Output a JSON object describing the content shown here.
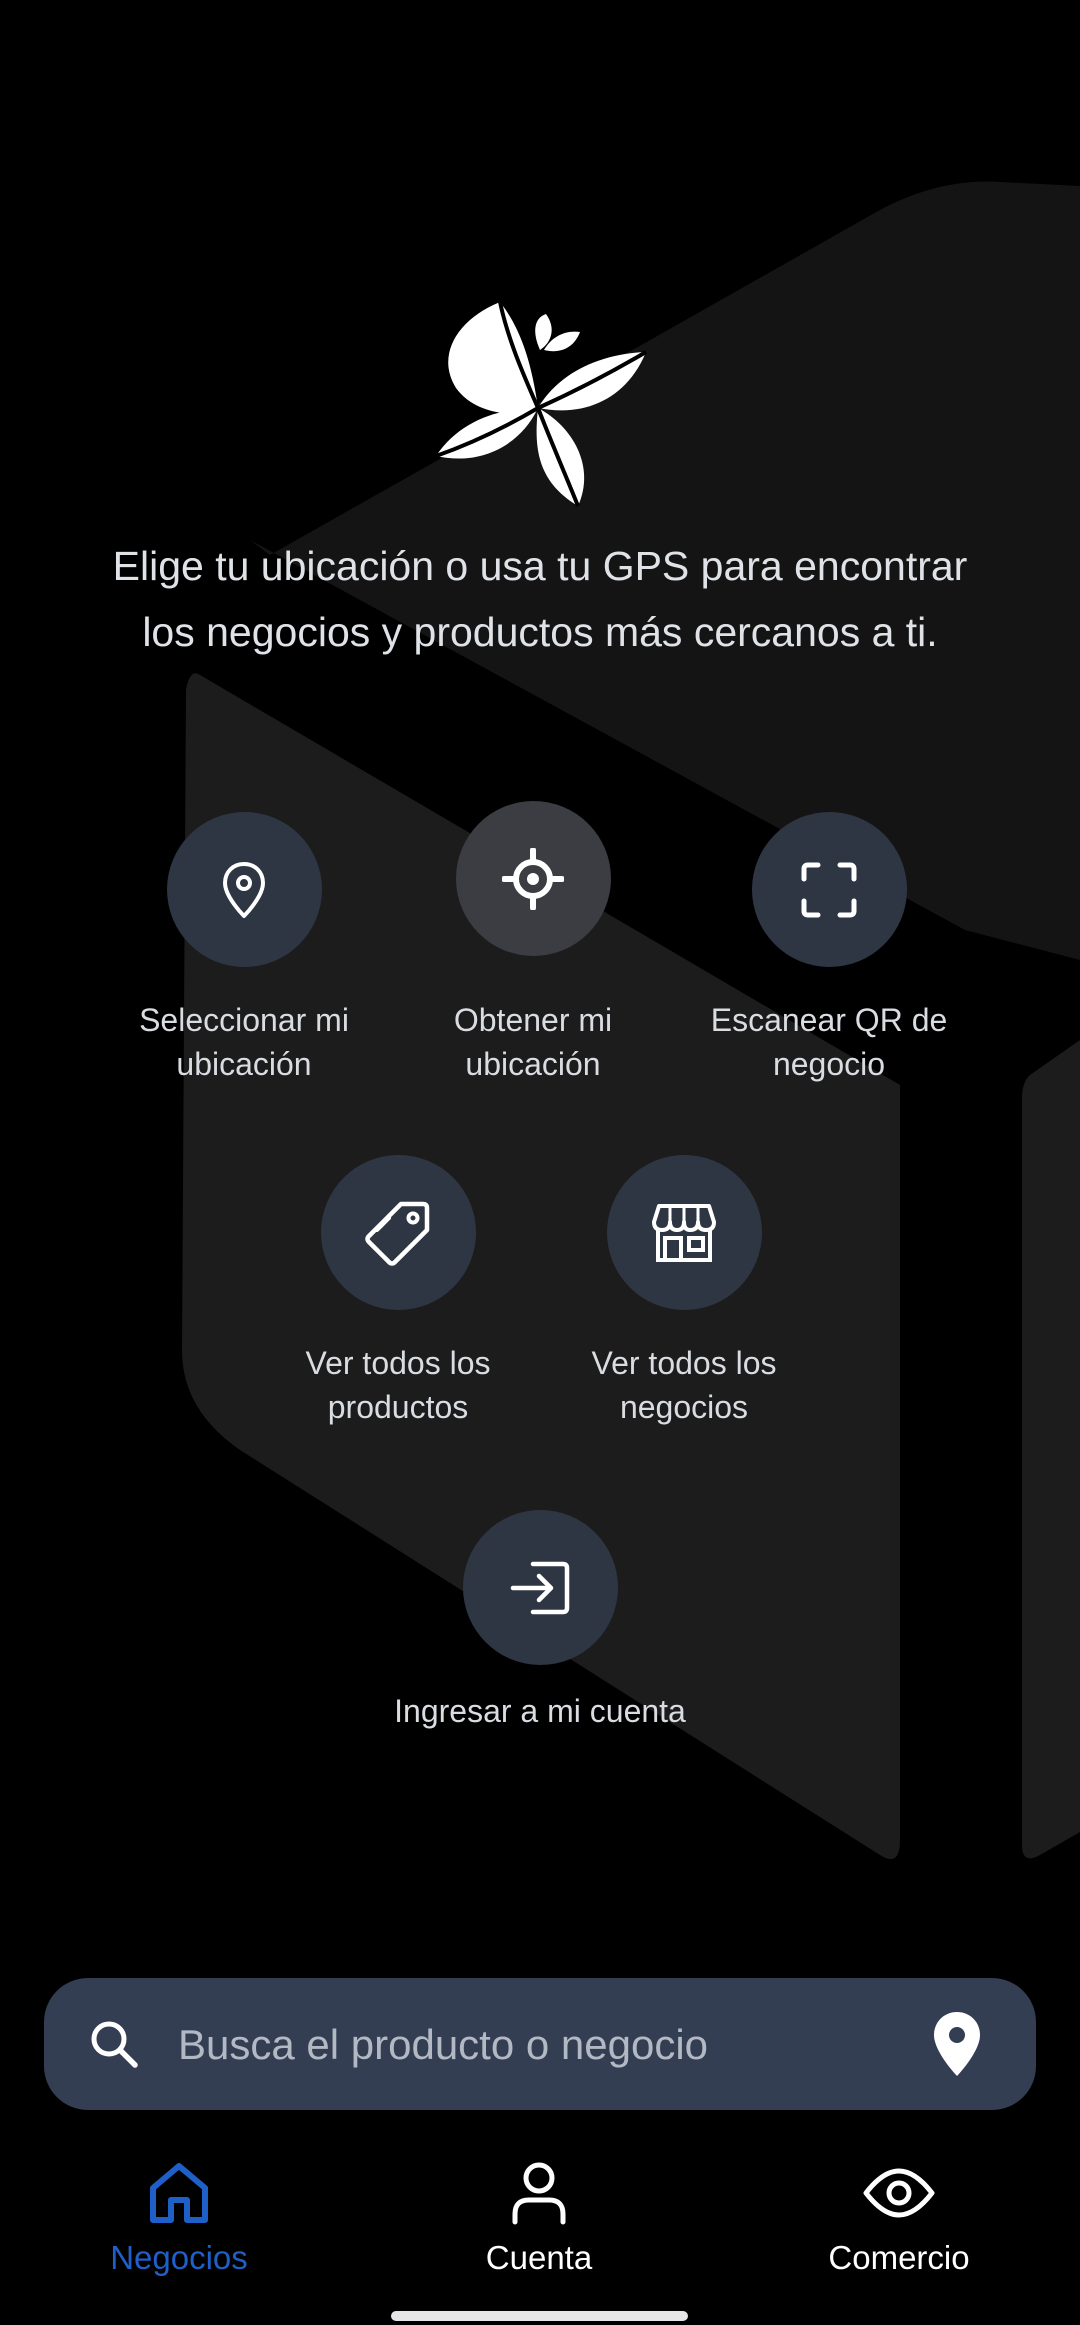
{
  "intro": {
    "line1": "Elige tu ubicación o usa tu GPS para encontrar",
    "line2": "los negocios y productos más cercanos a ti."
  },
  "actions": [
    {
      "line1": "Seleccionar mi",
      "line2": "ubicación",
      "icon": "map-pin-icon"
    },
    {
      "line1": "Obtener mi",
      "line2": "ubicación",
      "icon": "crosshair-icon"
    },
    {
      "line1": "Escanear QR de",
      "line2": "negocio",
      "icon": "qr-scan-icon"
    },
    {
      "line1": "Ver todos los",
      "line2": "productos",
      "icon": "tag-icon"
    },
    {
      "line1": "Ver todos los",
      "line2": "negocios",
      "icon": "store-icon"
    },
    {
      "line1": "Ingresar a mi cuenta",
      "line2": "",
      "icon": "login-icon"
    }
  ],
  "search": {
    "placeholder": "Busca el producto o negocio",
    "value": ""
  },
  "nav": {
    "items": [
      {
        "label": "Negocios",
        "icon": "home-icon",
        "active": true
      },
      {
        "label": "Cuenta",
        "icon": "user-icon",
        "active": false
      },
      {
        "label": "Comercio",
        "icon": "eye-icon",
        "active": false
      }
    ]
  },
  "colors": {
    "background": "#000000",
    "circle": "#2f3643",
    "search_bar": "#343e52",
    "accent": "#1f5fc8"
  }
}
